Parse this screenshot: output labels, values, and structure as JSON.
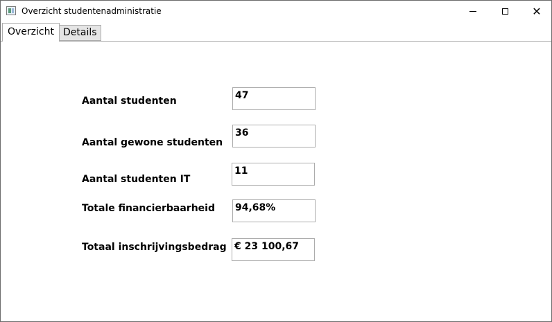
{
  "window": {
    "title": "Overzicht studentenadministratie",
    "controls": {
      "minimize_icon": "minimize-icon",
      "maximize_icon": "maximize-icon",
      "close_icon": "close-icon"
    }
  },
  "tabs": [
    {
      "label": "Overzicht",
      "active": true
    },
    {
      "label": "Details",
      "active": false
    }
  ],
  "overview": {
    "rows": [
      {
        "label": "Aantal studenten",
        "value": "47"
      },
      {
        "label": "Aantal gewone studenten",
        "value": "36"
      },
      {
        "label": "Aantal studenten IT",
        "value": "11"
      },
      {
        "label": "Totale financierbaarheid",
        "value": "94,68%"
      },
      {
        "label": "Totaal inschrijvingsbedrag",
        "value": "€ 23 100,67"
      }
    ]
  }
}
